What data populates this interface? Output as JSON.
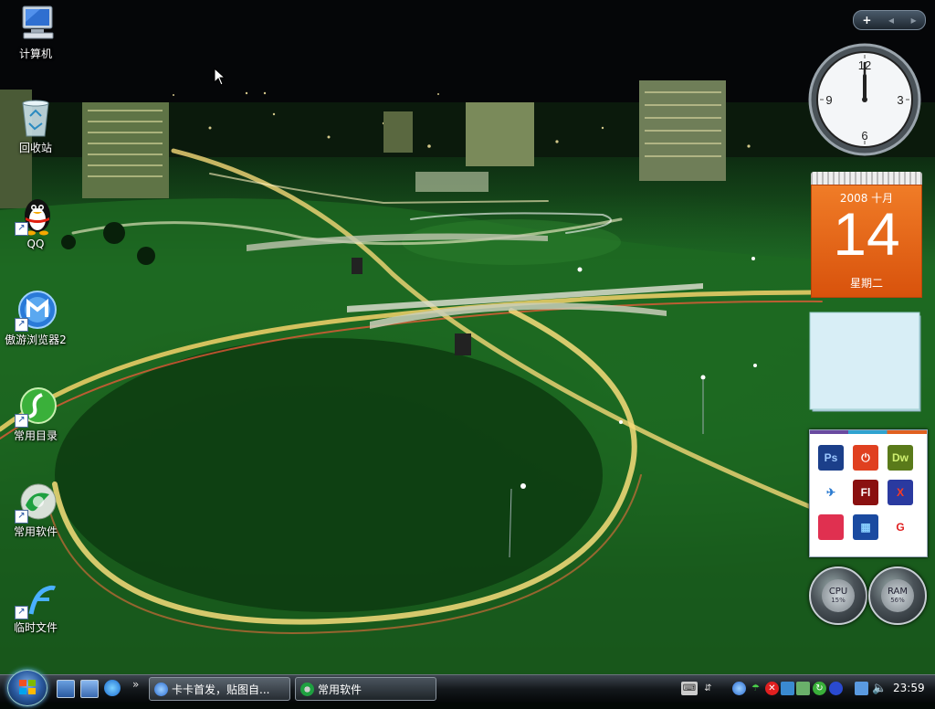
{
  "desktop": {
    "icons": [
      {
        "label": "计算机",
        "icon": "computer-icon",
        "shortcut": false
      },
      {
        "label": "回收站",
        "icon": "recycle-bin-icon",
        "shortcut": false
      },
      {
        "label": "QQ",
        "icon": "qq-penguin-icon",
        "shortcut": true
      },
      {
        "label": "傲游浏览器2",
        "icon": "maxthon-browser-icon",
        "shortcut": true
      },
      {
        "label": "常用目录",
        "icon": "green-folder-icon",
        "shortcut": true
      },
      {
        "label": "常用软件",
        "icon": "green-swirl-icon",
        "shortcut": true
      },
      {
        "label": "临时文件",
        "icon": "flash-icon",
        "shortcut": true
      }
    ]
  },
  "sidebar": {
    "controls": {
      "add": "+",
      "prev": "◂",
      "next": "▸"
    },
    "clock": {
      "hour": 12,
      "minute": 0,
      "numerals": [
        "12",
        "3",
        "6",
        "9"
      ]
    },
    "calendar": {
      "year_month": "2008 十月",
      "day": "14",
      "weekday": "星期二",
      "color": "#e8641a"
    },
    "launcher": {
      "apps": [
        {
          "name": "photoshop-icon",
          "text": "Ps",
          "bg": "#1b3f8a",
          "fg": "#9cc8ff"
        },
        {
          "name": "power-icon",
          "text": "⏻",
          "bg": "#e04020",
          "fg": "#ffffff"
        },
        {
          "name": "dreamweaver-icon",
          "text": "Dw",
          "bg": "#5a7a1a",
          "fg": "#d0f070"
        },
        {
          "name": "bird-app-icon",
          "text": "✈",
          "bg": "#ffffff",
          "fg": "#2a7ad0"
        },
        {
          "name": "flash-pro-icon",
          "text": "Fl",
          "bg": "#8a1010",
          "fg": "#ffffff"
        },
        {
          "name": "x-app-icon",
          "text": "X",
          "bg": "#2a3aa0",
          "fg": "#ff3a20"
        },
        {
          "name": "red-card-icon",
          "text": "",
          "bg": "#e03050",
          "fg": "#ffffff"
        },
        {
          "name": "film-icon",
          "text": "▦",
          "bg": "#1a4aa0",
          "fg": "#8ad0ff"
        },
        {
          "name": "g-app-icon",
          "text": "G",
          "bg": "#ffffff",
          "fg": "#e02020"
        }
      ]
    },
    "meters": [
      {
        "name": "CPU",
        "value": "15%"
      },
      {
        "name": "RAM",
        "value": "56%"
      }
    ]
  },
  "taskbar": {
    "more": "»",
    "tasks": [
      {
        "label": "卡卡首发，贴图自...",
        "icon": "maxthon-browser-icon"
      },
      {
        "label": "常用软件",
        "icon": "green-swirl-icon"
      }
    ],
    "time": "23:59"
  }
}
